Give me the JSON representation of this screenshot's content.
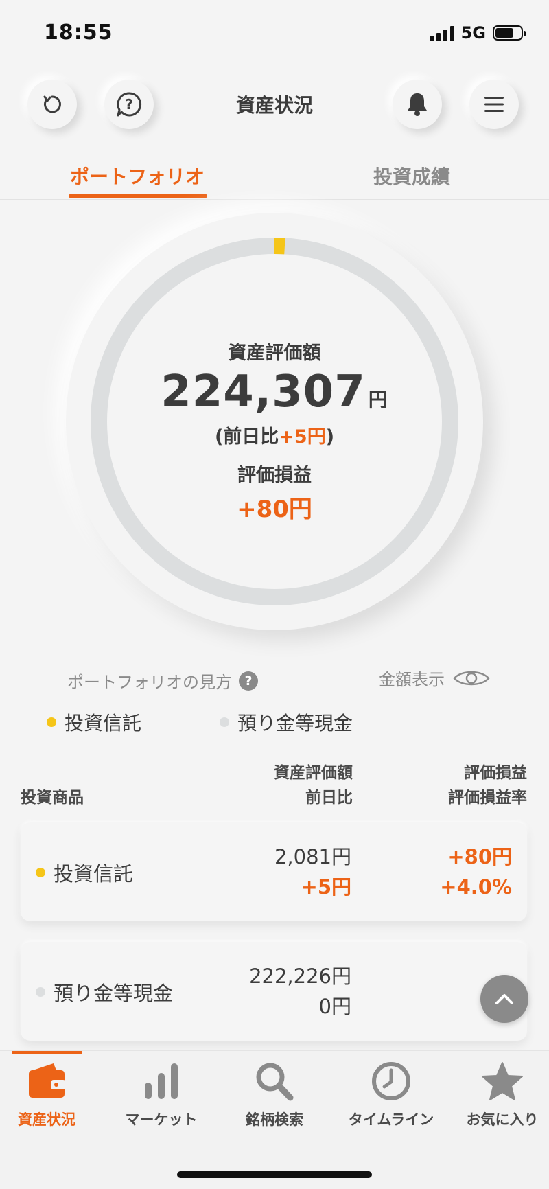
{
  "status": {
    "time": "18:55",
    "network": "5G"
  },
  "header": {
    "title": "資産状況"
  },
  "tabs": [
    {
      "label": "ポートフォリオ",
      "active": true
    },
    {
      "label": "投資成績",
      "active": false
    }
  ],
  "summary": {
    "asset_label": "資産評価額",
    "asset_value": "224,307",
    "unit": "円",
    "day_prefix": "(前日比",
    "day_change": "+5円",
    "day_suffix": ")",
    "pl_label": "評価損益",
    "pl_value": "+80円"
  },
  "ring": {
    "fund_share_percent": 0.93,
    "fund_color": "#f5c518",
    "cash_color": "#dcdedf"
  },
  "legend": {
    "howto_label": "ポートフォリオの見方",
    "show_amount_label": "金額表示",
    "items": [
      {
        "label": "投資信託",
        "color": "#f5c518"
      },
      {
        "label": "預り金等現金",
        "color": "#dcdedf"
      }
    ]
  },
  "table": {
    "col_product": "投資商品",
    "col_value_1": "資産評価額",
    "col_value_2": "前日比",
    "col_pl_1": "評価損益",
    "col_pl_2": "評価損益率",
    "rows": [
      {
        "name": "投資信託",
        "value": "2,081円",
        "change": "+5円",
        "pl": "+80円",
        "pl_rate": "+4.0%"
      },
      {
        "name": "預り金等現金",
        "value": "222,226円",
        "change": "0円",
        "pl": "",
        "pl_rate": ""
      }
    ]
  },
  "nav": [
    {
      "label": "資産状況",
      "icon": "wallet-icon",
      "active": true
    },
    {
      "label": "マーケット",
      "icon": "bar-chart-icon",
      "active": false
    },
    {
      "label": "銘柄検索",
      "icon": "search-icon",
      "active": false
    },
    {
      "label": "タイムライン",
      "icon": "clock-icon",
      "active": false
    },
    {
      "label": "お気に入り",
      "icon": "star-icon",
      "active": false
    }
  ],
  "colors": {
    "accent": "#ec6317",
    "text": "#3c3c3c",
    "muted": "#8a8a8a"
  }
}
